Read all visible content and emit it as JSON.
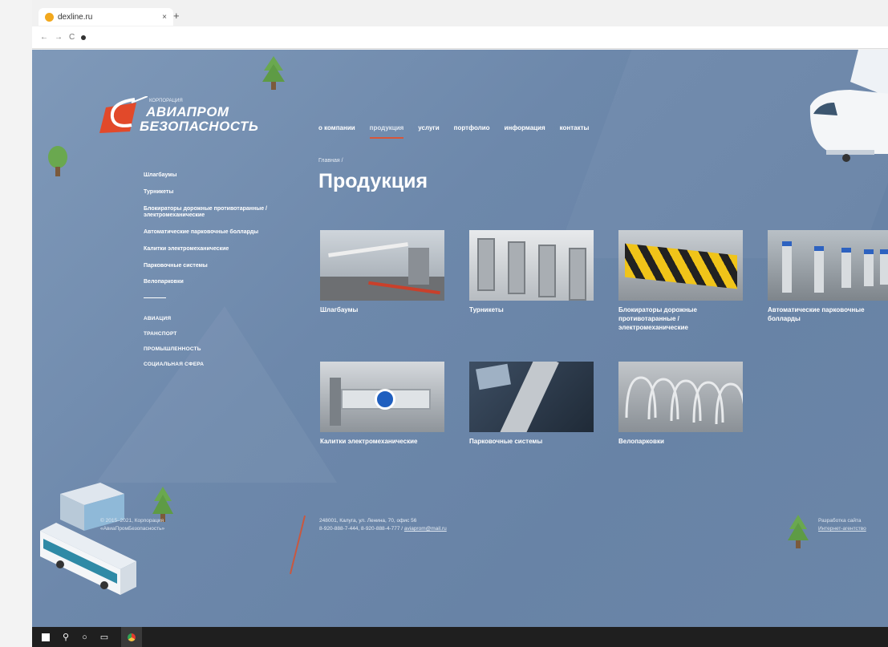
{
  "browser": {
    "tab_title": "dexline.ru",
    "tab_close": "×",
    "new_tab": "+",
    "nav_back": "←",
    "nav_forward": "→",
    "nav_reload": "C"
  },
  "logo": {
    "small": "КОРПОРАЦИЯ",
    "line1": "АВИАПРОМ",
    "line2": "БЕЗОПАСНОСТЬ"
  },
  "nav": {
    "items": [
      "о компании",
      "продукция",
      "услуги",
      "портфолио",
      "информация",
      "контакты"
    ],
    "active": "продукция"
  },
  "breadcrumb": "Главная  /",
  "page_title": "Продукция",
  "sidebar": {
    "items": [
      "Шлагбаумы",
      "Турникеты",
      "Блокираторы дорожные противотаранные / электромеханические",
      "Автоматические парковочные болларды",
      "Калитки электромеханические",
      "Парковочные системы",
      "Велопарковки"
    ],
    "categories": [
      "АВИАЦИЯ",
      "ТРАНСПОРТ",
      "ПРОМЫШЛЕННОСТЬ",
      "СОЦИАЛЬНАЯ СФЕРА"
    ]
  },
  "products": [
    {
      "caption": "Шлагбаумы"
    },
    {
      "caption": "Турникеты"
    },
    {
      "caption": "Блокираторы дорожные противотаранные / электромеханические"
    },
    {
      "caption": "Автоматические парковочные болларды"
    },
    {
      "caption": "Калитки электромеханические"
    },
    {
      "caption": "Парковочные системы"
    },
    {
      "caption": "Велопарковки"
    }
  ],
  "footer": {
    "copyright_line1": "© 2015–2021, Корпорация",
    "copyright_line2": "«АвиаПромБезопасность»",
    "address": "248001, Калуга, ул. Ленина, 70, офис 56",
    "phones": "8-920-888-7-444, 8-920-888-4-777  /",
    "email": "aviaprom@mail.ru",
    "dev_line1": "Разработка сайта",
    "dev_line2": "Интернет-агентство"
  },
  "colors": {
    "accent": "#d8563a",
    "page_bg": "#6d88ab"
  }
}
